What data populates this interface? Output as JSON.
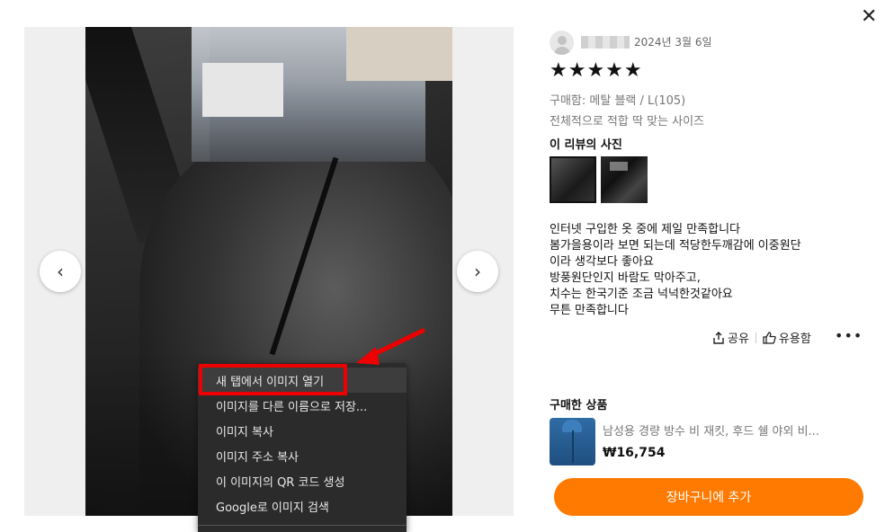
{
  "review": {
    "date": "2024년 3월 6일",
    "stars": "★★★★★",
    "option": "구매함: 메탈 블랙 / L(105)",
    "fit": "전체적으로 적합 딱 맞는 사이즈",
    "photos_title": "이 리뷰의 사진",
    "body_lines": [
      "인터넷 구입한 옷 중에 제일 만족합니다",
      "봄가을용이라 보면 되는데 적당한두깨감에 이중원단",
      "이라 생각보다 좋아요",
      "방풍원단인지 바람도 막아주고,",
      "치수는 한국기준 조금 넉넉한것같아요",
      "무튼 만족합니다"
    ],
    "share_label": "공유",
    "helpful_label": "유용함",
    "more_label": "•••"
  },
  "viewer": {
    "prev_icon": "‹",
    "next_icon": "›"
  },
  "context_menu": {
    "items": [
      "새 탭에서 이미지 열기",
      "이미지를 다른 이름으로 저장...",
      "이미지 복사",
      "이미지 주소 복사",
      "이 이미지의 QR 코드 생성",
      "Google로 이미지 검색"
    ],
    "highlight_color": "#e00000"
  },
  "product": {
    "section_title": "구매한 상품",
    "name": "남성용 경량 방수 비 재킷, 후드 쉘 야외 비...",
    "price": "₩16,754"
  },
  "cart_button": {
    "label": "장바구니에 추가",
    "color": "#ff7a00"
  },
  "close_icon": "✕"
}
